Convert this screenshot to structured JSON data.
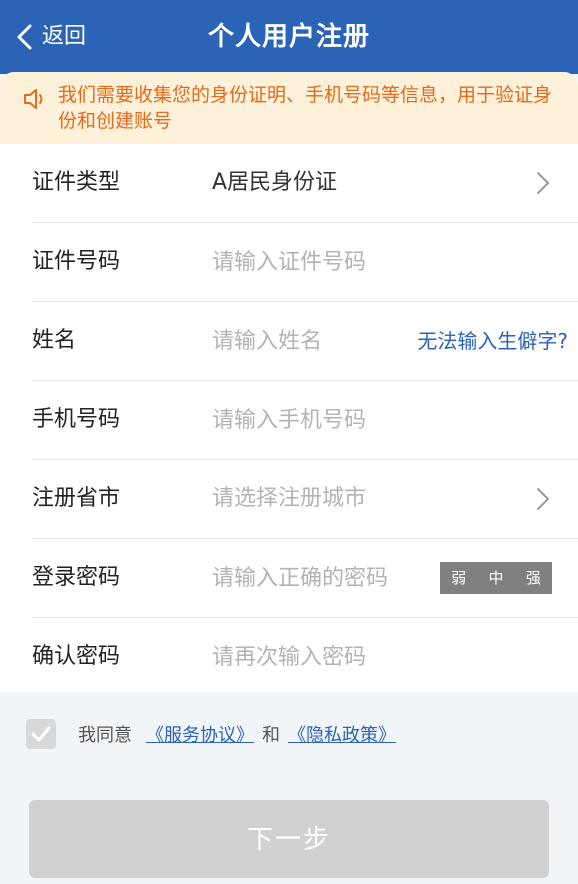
{
  "header": {
    "back_label": "返回",
    "title": "个人用户注册"
  },
  "notice": {
    "text": "我们需要收集您的身份证明、手机号码等信息，用于验证身份和创建账号"
  },
  "form": {
    "id_type": {
      "label": "证件类型",
      "value": "A居民身份证"
    },
    "id_number": {
      "label": "证件号码",
      "placeholder": "请输入证件号码"
    },
    "name": {
      "label": "姓名",
      "placeholder": "请输入姓名",
      "link": "无法输入生僻字?"
    },
    "phone": {
      "label": "手机号码",
      "placeholder": "请输入手机号码"
    },
    "city": {
      "label": "注册省市",
      "placeholder": "请选择注册城市"
    },
    "password": {
      "label": "登录密码",
      "placeholder": "请输入正确的密码",
      "strength": {
        "weak": "弱",
        "medium": "中",
        "strong": "强"
      }
    },
    "confirm": {
      "label": "确认密码",
      "placeholder": "请再次输入密码"
    }
  },
  "agreement": {
    "prefix": "我同意",
    "service": "《服务协议》",
    "and": "和",
    "privacy": "《隐私政策》"
  },
  "next_button": "下一步",
  "colors": {
    "header_bg": "#2b63b6",
    "notice_bg": "#fdf1d9",
    "notice_text": "#e46a1c",
    "link": "#2b63b6",
    "button_disabled": "#cfd1d3"
  }
}
